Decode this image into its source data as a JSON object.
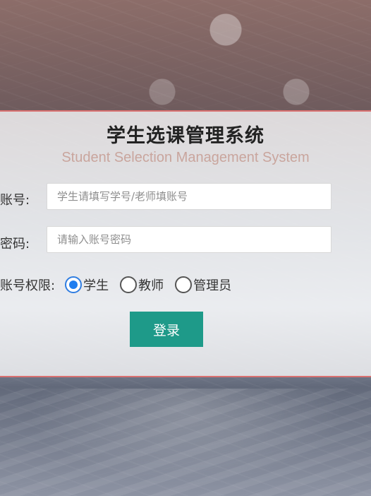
{
  "page": {
    "title": "学生选课管理系统",
    "subtitle": "Student Selection Management System"
  },
  "form": {
    "account_label": "账号:",
    "account_placeholder": "学生请填写学号/老师填账号",
    "password_label": "密码:",
    "password_placeholder": "请输入账号密码",
    "role_label": "账号权限:",
    "roles": [
      {
        "label": "学生",
        "selected": true
      },
      {
        "label": "教师",
        "selected": false
      },
      {
        "label": "管理员",
        "selected": false
      }
    ],
    "login_button": "登录"
  },
  "colors": {
    "panel_border": "#d97070",
    "subtitle": "#c9a59d",
    "radio_selected": "#1f7ef0",
    "login_button": "#1e9a89"
  }
}
